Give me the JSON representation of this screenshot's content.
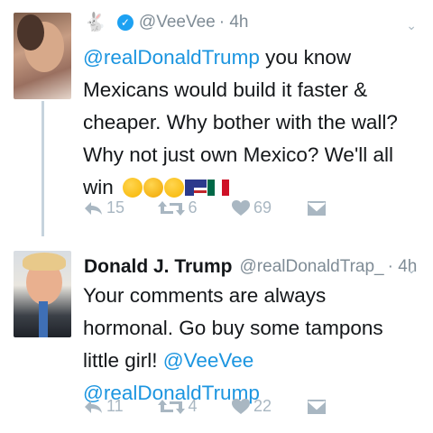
{
  "tweets": [
    {
      "handle": "@VeeVee",
      "time": "· 4h",
      "mention": "@realDonaldTrump",
      "text": "you know Mexicans would build it faster & cheaper. Why bother with the wall? Why not just own Mexico? We'll all win",
      "emoji_names": [
        "thinking-face",
        "flushed-face",
        "winking-face",
        "us-flag",
        "mexico-flag"
      ],
      "replies": "15",
      "retweets": "6",
      "likes": "69"
    },
    {
      "name": "Donald J. Trump",
      "handle": "@realDonaldTrap_",
      "time": "· 4h",
      "text": "Your comments are always hormonal. Go buy some tampons little girl!",
      "mention1": "@VeeVee",
      "mention2": "@realDonaldTrump",
      "replies": "11",
      "retweets": "4",
      "likes": "22"
    }
  ],
  "colors": {
    "link": "#1b95e0",
    "muted": "#7f8c96",
    "icon": "#a9b7c2",
    "verified": "#1da1f2"
  }
}
